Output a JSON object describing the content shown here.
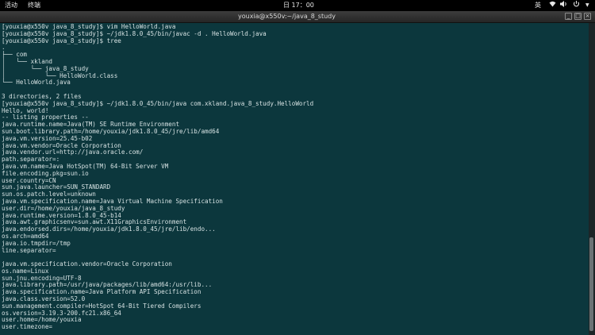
{
  "topbar": {
    "activities": "活动",
    "app_menu": "终端",
    "clock": "日 17：00",
    "input_method": "英",
    "network_icon": "network-icon",
    "volume_icon": "volume-icon",
    "power_icon": "power-icon",
    "menu_icon": "chevron-down-icon"
  },
  "window": {
    "title": "youxia@x550v:~/java_8_study",
    "buttons": {
      "minimize": "_",
      "maximize": "□",
      "close": "×"
    }
  },
  "terminal": {
    "lines": [
      "[youxia@x550v java_8_study]$ vim HelloWorld.java",
      "[youxia@x550v java_8_study]$ ~/jdk1.8.0_45/bin/javac -d . HelloWorld.java",
      "[youxia@x550v java_8_study]$ tree",
      ".",
      "├── com",
      "│   └── xkland",
      "│       └── java_8_study",
      "│           └── HelloWorld.class",
      "└── HelloWorld.java",
      "",
      "3 directories, 2 files",
      "[youxia@x550v java_8_study]$ ~/jdk1.8.0_45/bin/java com.xkland.java_8_study.HelloWorld",
      "Hello, world!",
      "-- listing properties --",
      "java.runtime.name=Java(TM) SE Runtime Environment",
      "sun.boot.library.path=/home/youxia/jdk1.8.0_45/jre/lib/amd64",
      "java.vm.version=25.45-b02",
      "java.vm.vendor=Oracle Corporation",
      "java.vendor.url=http://java.oracle.com/",
      "path.separator=:",
      "java.vm.name=Java HotSpot(TM) 64-Bit Server VM",
      "file.encoding.pkg=sun.io",
      "user.country=CN",
      "sun.java.launcher=SUN_STANDARD",
      "sun.os.patch.level=unknown",
      "java.vm.specification.name=Java Virtual Machine Specification",
      "user.dir=/home/youxia/java_8_study",
      "java.runtime.version=1.8.0_45-b14",
      "java.awt.graphicsenv=sun.awt.X11GraphicsEnvironment",
      "java.endorsed.dirs=/home/youxia/jdk1.8.0_45/jre/lib/endo...",
      "os.arch=amd64",
      "java.io.tmpdir=/tmp",
      "line.separator=",
      "",
      "java.vm.specification.vendor=Oracle Corporation",
      "os.name=Linux",
      "sun.jnu.encoding=UTF-8",
      "java.library.path=/usr/java/packages/lib/amd64:/usr/lib...",
      "java.specification.name=Java Platform API Specification",
      "java.class.version=52.0",
      "sun.management.compiler=HotSpot 64-Bit Tiered Compilers",
      "os.version=3.19.3-200.fc21.x86_64",
      "user.home=/home/youxia",
      "user.timezone="
    ]
  }
}
